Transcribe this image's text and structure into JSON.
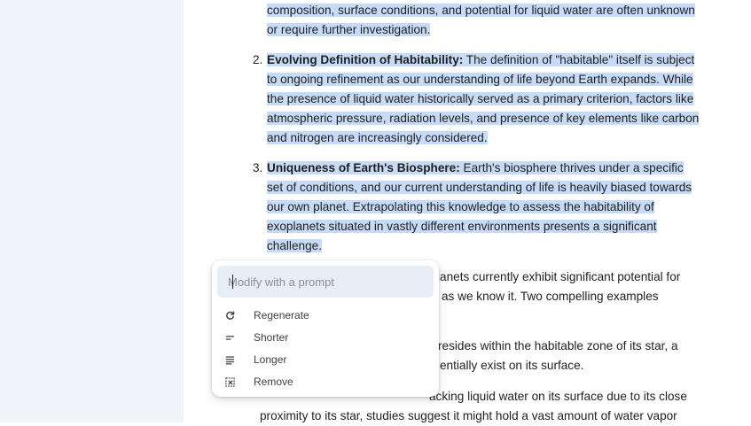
{
  "document": {
    "intro_line1": "composition, surface conditions, and potential for liquid water are often unknown",
    "intro_line2": "or require further investigation.",
    "items": [
      {
        "number": "2.",
        "title": "Evolving Definition of Habitability:",
        "lines": [
          " The definition of \"habitable\" itself is subject",
          "to ongoing refinement as our understanding of life beyond Earth expands. While",
          "the presence of liquid water historically served as a primary criterion, factors like",
          "atmospheric pressure, radiation levels, and presence of key elements like carbon",
          "and nitrogen are increasingly considered."
        ]
      },
      {
        "number": "3.",
        "title": "Uniqueness of Earth's Biosphere:",
        "lines": [
          " Earth's biosphere thrives under a specific",
          "set of conditions, and our current understanding of life is heavily biased towards",
          "our own planet. Extrapolating this knowledge to assess the habitability of",
          "exoplanets situated in vastly different environments presents a significant",
          "challenge."
        ]
      }
    ],
    "partial_lines": [
      "lanets currently exhibit significant potential for",
      "as we know it. Two compelling examples",
      "resides within the habitable zone of its star, a",
      "entially exist on its surface.",
      "acking liquid water on its surface due to its close",
      "proximity to its star,  studies suggest it might hold a vast amount of water vapor"
    ]
  },
  "popup": {
    "placeholder": "Modify with a prompt",
    "menu": [
      {
        "label": "Regenerate",
        "icon": "refresh-icon"
      },
      {
        "label": "Shorter",
        "icon": "shorter-icon"
      },
      {
        "label": "Longer",
        "icon": "longer-icon"
      },
      {
        "label": "Remove",
        "icon": "remove-icon"
      }
    ]
  },
  "colors": {
    "selection_highlight": "#c7dbf7",
    "sidebar_background": "#f0f4f9",
    "prompt_background": "#e8eef6"
  }
}
